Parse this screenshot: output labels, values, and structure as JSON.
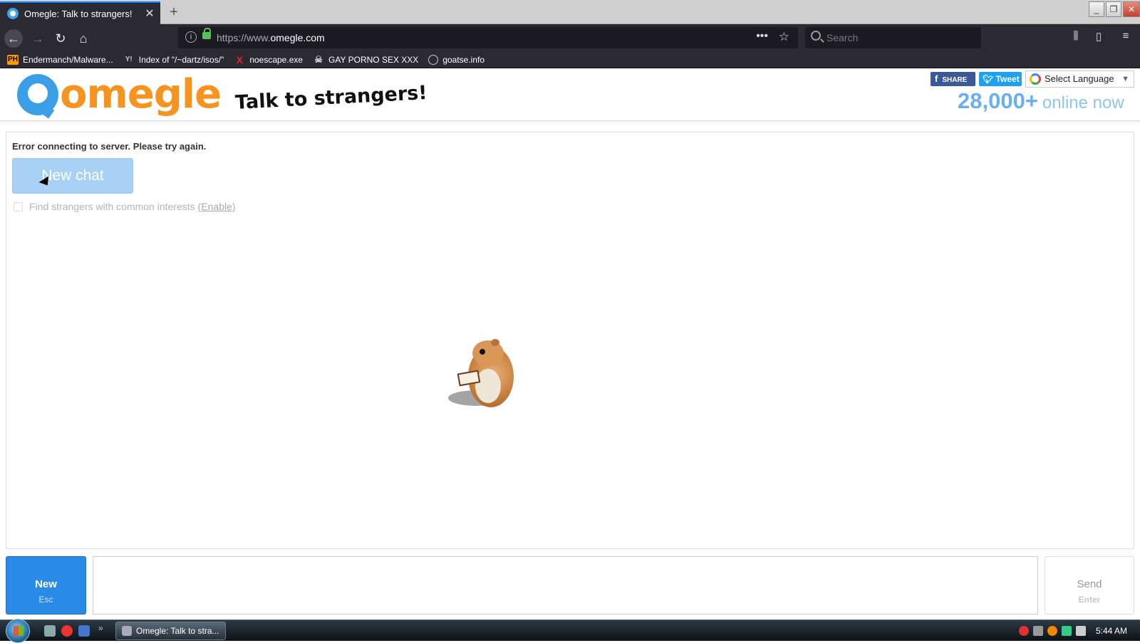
{
  "browser": {
    "tab_title": "Omegle: Talk to strangers!",
    "tab_close": "✕",
    "new_tab": "+",
    "url_prefix": "https://www.",
    "url_domain": "omegle.com",
    "search_placeholder": "Search",
    "bookmarks": [
      {
        "icon": "PH",
        "label": "Endermanch/Malware..."
      },
      {
        "icon": "Y!",
        "label": "Index of \"/~dartz/isos/\""
      },
      {
        "icon": "X",
        "label": "noescape.exe"
      },
      {
        "icon": "☠",
        "label": "GAY PORNO SEX XXX"
      },
      {
        "icon": "",
        "label": "goatse.info"
      }
    ]
  },
  "header": {
    "logo_text": "omegle",
    "tagline": "Talk to strangers!",
    "share_label": "SHARE",
    "tweet_label": "Tweet",
    "language_label": "Select Language",
    "online_count": "28,000+",
    "online_label": "online now"
  },
  "chat": {
    "error_message": "Error connecting to server. Please try again.",
    "new_chat_label": "New chat",
    "interests_label": "Find strangers with common interests",
    "enable_label": "(Enable)"
  },
  "controls": {
    "new_label": "New",
    "new_hint": "Esc",
    "send_label": "Send",
    "send_hint": "Enter",
    "message_value": ""
  },
  "taskbar": {
    "task_title": "Omegle: Talk to stra...",
    "clock": "5:44 AM"
  },
  "colors": {
    "brand_orange": "#f7931e",
    "brand_blue": "#3a9fe6",
    "new_button": "#2a8ae8",
    "online_blue": "#6ab0ee"
  }
}
